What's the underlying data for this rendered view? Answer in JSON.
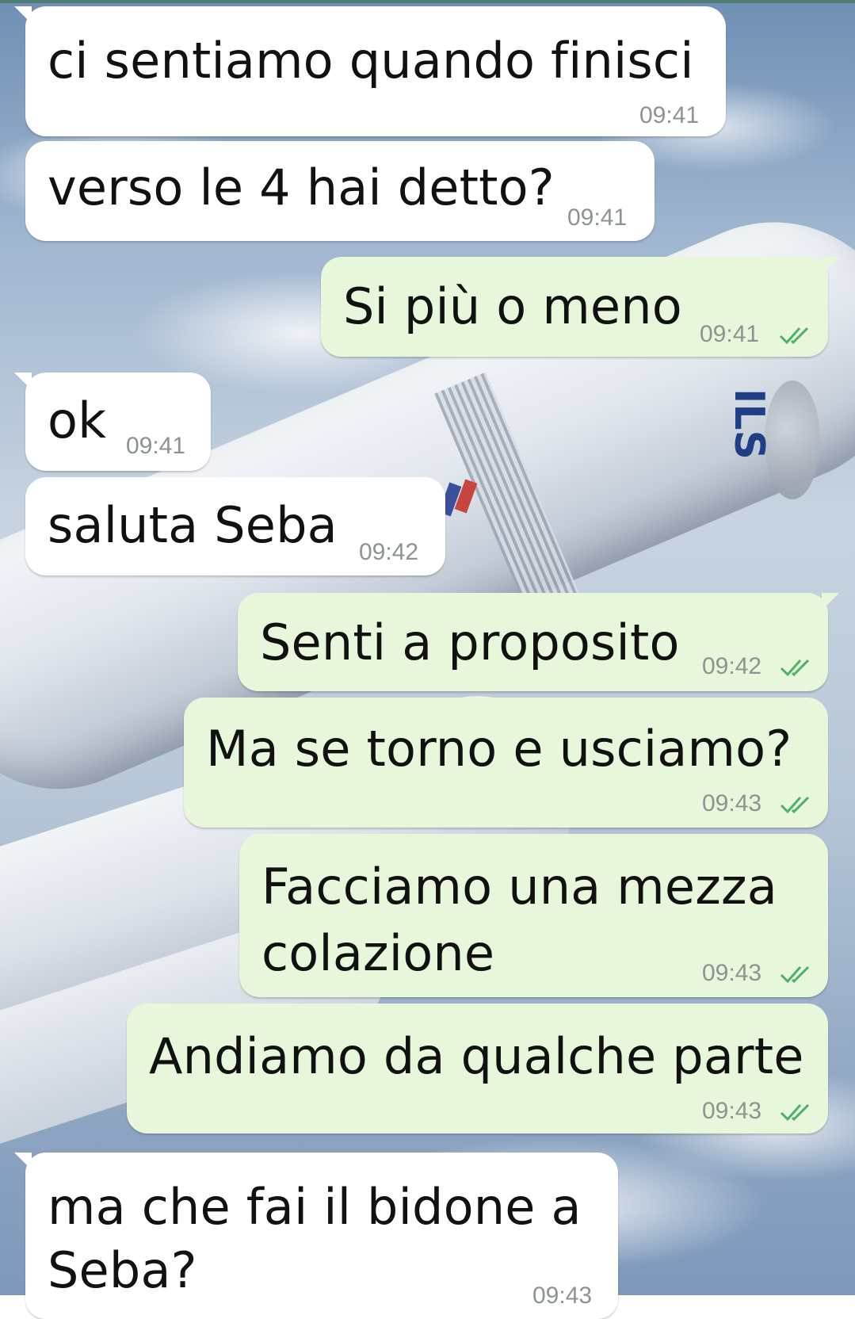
{
  "conversation": {
    "messages": [
      {
        "id": "m1",
        "direction": "incoming",
        "text": "ci sentiamo quando finisci",
        "time": "09:41"
      },
      {
        "id": "m2",
        "direction": "incoming",
        "text": "verso le 4 hai detto?",
        "time": "09:41"
      },
      {
        "id": "m3",
        "direction": "outgoing",
        "text": "Si più o meno",
        "time": "09:41",
        "status": "read"
      },
      {
        "id": "m4",
        "direction": "incoming",
        "text": "ok",
        "time": "09:41"
      },
      {
        "id": "m5",
        "direction": "incoming",
        "text": "saluta Seba",
        "time": "09:42"
      },
      {
        "id": "m6",
        "direction": "outgoing",
        "text": "Senti a proposito",
        "time": "09:42",
        "status": "read"
      },
      {
        "id": "m7",
        "direction": "outgoing",
        "text": "Ma se torno e usciamo?",
        "time": "09:43",
        "status": "read"
      },
      {
        "id": "m8",
        "direction": "outgoing",
        "text_line1": "Facciamo una mezza",
        "text_line2": "colazione",
        "time": "09:43",
        "status": "read"
      },
      {
        "id": "m9",
        "direction": "outgoing",
        "text": "Andiamo da qualche parte",
        "time": "09:43",
        "status": "read"
      },
      {
        "id": "m10",
        "direction": "incoming",
        "text_line1": "ma che fai il bidone a",
        "text_line2": "Seba?",
        "time": "09:43"
      }
    ]
  },
  "background": {
    "wallpaper_text": "ILS"
  },
  "colors": {
    "incoming_bubble": "#ffffff",
    "outgoing_bubble": "#e8f7dc",
    "timestamp": "#8b9491",
    "read_ticks": "#4fb06a"
  }
}
